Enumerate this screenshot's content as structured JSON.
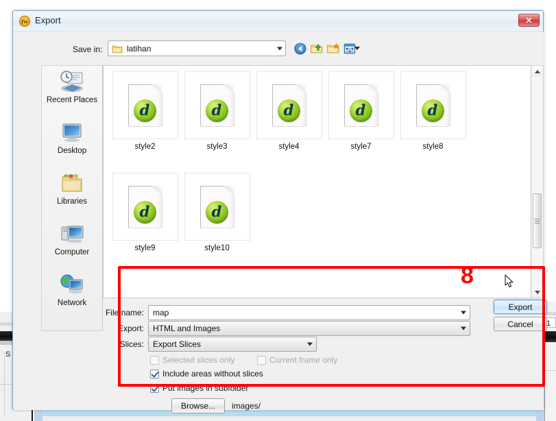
{
  "window": {
    "title": "Export",
    "app_icon": "fireworks-icon",
    "close_label": "✕"
  },
  "toolbar": {
    "save_in_label": "Save in:",
    "current_folder": "latihan",
    "buttons": [
      {
        "name": "back-icon",
        "tooltip": "Back"
      },
      {
        "name": "up-folder-icon",
        "tooltip": "Up One Level"
      },
      {
        "name": "new-folder-icon",
        "tooltip": "Create New Folder"
      },
      {
        "name": "views-icon",
        "tooltip": "Views"
      }
    ]
  },
  "places": {
    "items": [
      {
        "label": "Recent Places",
        "icon": "recent-places-icon"
      },
      {
        "label": "Desktop",
        "icon": "desktop-icon"
      },
      {
        "label": "Libraries",
        "icon": "libraries-icon"
      },
      {
        "label": "Computer",
        "icon": "computer-icon"
      },
      {
        "label": "Network",
        "icon": "network-icon"
      }
    ]
  },
  "files": {
    "items": [
      {
        "name": "style2",
        "icon": "dreamweaver-file-icon"
      },
      {
        "name": "style3",
        "icon": "dreamweaver-file-icon"
      },
      {
        "name": "style4",
        "icon": "dreamweaver-file-icon"
      },
      {
        "name": "style7",
        "icon": "dreamweaver-file-icon"
      },
      {
        "name": "style8",
        "icon": "dreamweaver-file-icon"
      },
      {
        "name": "style9",
        "icon": "dreamweaver-file-icon"
      },
      {
        "name": "style10",
        "icon": "dreamweaver-file-icon"
      }
    ]
  },
  "form": {
    "file_name_label": "File name:",
    "file_name_value": "map",
    "export_label": "Export:",
    "export_value": "HTML and Images",
    "slices_label": "Slices:",
    "slices_value": "Export Slices",
    "checkboxes": [
      {
        "label": "Selected slices only",
        "checked": false,
        "disabled": true
      },
      {
        "label": "Current frame only",
        "checked": false,
        "disabled": true
      },
      {
        "label": "Include areas without slices",
        "checked": true,
        "disabled": false
      },
      {
        "label": "Put images in subfolder",
        "checked": true,
        "disabled": false
      }
    ],
    "browse_label": "Browse...",
    "subfolder_path": "images/"
  },
  "actions": {
    "export_label": "Export",
    "cancel_label": "Cancel"
  },
  "annotation": {
    "step_number": "8",
    "highlight_color": "#ff0000"
  },
  "background": {
    "left_letter": "S",
    "right_number": "1"
  }
}
